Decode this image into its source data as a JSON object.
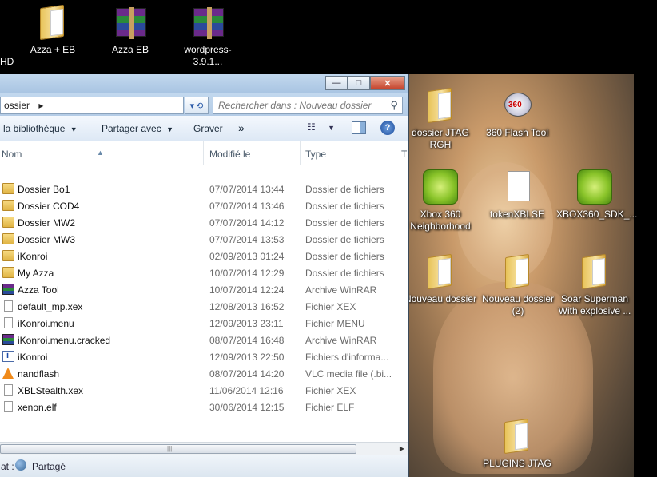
{
  "desktop": {
    "top_cut_label": "HD",
    "icons": [
      {
        "name": "desktop-icon-azza-eb-folder",
        "label": "Azza + EB",
        "icon": "folder-icon"
      },
      {
        "name": "desktop-icon-azza-eb-archive",
        "label": "Azza   EB",
        "icon": "winrar-archive-icon"
      },
      {
        "name": "desktop-icon-wordpress",
        "label": "wordpress-3.9.1...",
        "icon": "winrar-archive-icon"
      },
      {
        "name": "desktop-icon-dossier-jtag",
        "label": "dossier JTAG RGH",
        "icon": "folder-icon"
      },
      {
        "name": "desktop-icon-360-flash-tool",
        "label": "360 Flash Tool",
        "icon": "flash-tool-icon"
      },
      {
        "name": "desktop-icon-xbox-360-neighborhood",
        "label": "Xbox 360 Neighborhood",
        "icon": "xbox-icon"
      },
      {
        "name": "desktop-icon-tokenxblse",
        "label": "tokenXBLSE",
        "icon": "text-file-icon"
      },
      {
        "name": "desktop-icon-xbox360-sdk",
        "label": "XBOX360_SDK_...",
        "icon": "xbox-installer-icon"
      },
      {
        "name": "desktop-icon-nouveau-dossier",
        "label": "Nouveau dossier",
        "icon": "folder-icon"
      },
      {
        "name": "desktop-icon-nouveau-dossier-2",
        "label": "Nouveau dossier (2)",
        "icon": "folder-icon"
      },
      {
        "name": "desktop-icon-soar-superman",
        "label": "Soar Superman With explosive ...",
        "icon": "folder-icon"
      },
      {
        "name": "desktop-icon-plugins-jtag",
        "label": "PLUGINS JTAG",
        "icon": "folder-icon"
      }
    ]
  },
  "window": {
    "title_buttons": {
      "minimize": "—",
      "maximize": "□",
      "close": "✕"
    },
    "address": {
      "path_partial": "ossier",
      "separator": "▸"
    },
    "search": {
      "placeholder": "Rechercher dans : Nouveau dossier"
    },
    "toolbar": {
      "library_label": "la bibliothèque",
      "share_label": "Partager avec",
      "burn_label": "Graver",
      "more_label": "»"
    },
    "columns": {
      "name": "Nom",
      "modified": "Modifié le",
      "type": "Type",
      "next": "T"
    },
    "files": [
      {
        "name": "Dossier Bo1",
        "date": "07/07/2014 13:44",
        "type": "Dossier de fichiers",
        "kind": "folder"
      },
      {
        "name": "Dossier COD4",
        "date": "07/07/2014 13:46",
        "type": "Dossier de fichiers",
        "kind": "folder"
      },
      {
        "name": "Dossier MW2",
        "date": "07/07/2014 14:12",
        "type": "Dossier de fichiers",
        "kind": "folder"
      },
      {
        "name": "Dossier MW3",
        "date": "07/07/2014 13:53",
        "type": "Dossier de fichiers",
        "kind": "folder"
      },
      {
        "name": "iKonroi",
        "date": "02/09/2013 01:24",
        "type": "Dossier de fichiers",
        "kind": "folder"
      },
      {
        "name": "My Azza",
        "date": "10/07/2014 12:29",
        "type": "Dossier de fichiers",
        "kind": "folder"
      },
      {
        "name": "Azza Tool",
        "date": "10/07/2014 12:24",
        "type": "Archive WinRAR",
        "kind": "rar"
      },
      {
        "name": "default_mp.xex",
        "date": "12/08/2013 16:52",
        "type": "Fichier XEX",
        "kind": "file"
      },
      {
        "name": "iKonroi.menu",
        "date": "12/09/2013 23:11",
        "type": "Fichier MENU",
        "kind": "file"
      },
      {
        "name": "iKonroi.menu.cracked",
        "date": "08/07/2014 16:48",
        "type": "Archive WinRAR",
        "kind": "rar"
      },
      {
        "name": "iKonroi",
        "date": "12/09/2013 22:50",
        "type": "Fichiers d'informa...",
        "kind": "nfo"
      },
      {
        "name": "nandflash",
        "date": "08/07/2014 14:20",
        "type": "VLC media file (.bi...",
        "kind": "vlc"
      },
      {
        "name": "XBLStealth.xex",
        "date": "11/06/2014 12:16",
        "type": "Fichier XEX",
        "kind": "file"
      },
      {
        "name": "xenon.elf",
        "date": "30/06/2014 12:15",
        "type": "Fichier ELF",
        "kind": "file"
      }
    ],
    "status": {
      "partial_label": "at :",
      "shared_label": "Partagé"
    }
  }
}
